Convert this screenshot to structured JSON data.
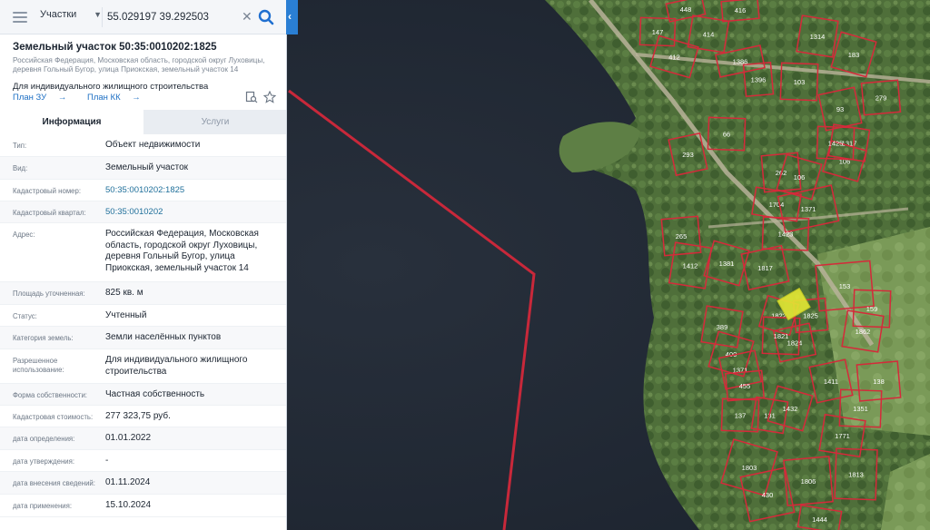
{
  "search": {
    "layer": "Участки",
    "query": "55.029197 39.292503"
  },
  "parcel": {
    "title": "Земельный участок 50:35:0010202:1825",
    "address": "Российская Федерация, Московская область, городской округ Луховицы, деревня Гольный Бугор, улица Приокская, земельный участок 14",
    "use": "Для индивидуального жилищного строительства",
    "plan_zu": "План ЗУ",
    "plan_kk": "План КК"
  },
  "tabs": {
    "info": "Информация",
    "services": "Услуги"
  },
  "fields": [
    {
      "label": "Тип:",
      "value": "Объект недвижимости"
    },
    {
      "label": "Вид:",
      "value": "Земельный участок"
    },
    {
      "label": "Кадастровый номер:",
      "value": "50:35:0010202:1825"
    },
    {
      "label": "Кадастровый квартал:",
      "value": "50:35:0010202"
    },
    {
      "label": "Адрес:",
      "value": "Российская Федерация, Московская область, городской округ Луховицы, деревня Гольный Бугор, улица Приокская, земельный участок 14"
    },
    {
      "label": "Площадь уточненная:",
      "value": "825 кв. м"
    },
    {
      "label": "Статус:",
      "value": "Учтенный"
    },
    {
      "label": "Категория земель:",
      "value": "Земли населённых пунктов"
    },
    {
      "label": "Разрешенное использование:",
      "value": "Для индивидуального жилищного строительства"
    },
    {
      "label": "Форма собственности:",
      "value": "Частная собственность"
    },
    {
      "label": "Кадастровая стоимость:",
      "value": "277 323,75 руб."
    },
    {
      "label": "дата определения:",
      "value": "01.01.2022"
    },
    {
      "label": "дата утверждения:",
      "value": "-"
    },
    {
      "label": "дата внесения сведений:",
      "value": "01.11.2024"
    },
    {
      "label": "дата применения:",
      "value": "15.10.2024"
    }
  ],
  "map": {
    "parcel_numbers": [
      "448",
      "416",
      "147",
      "414",
      "412",
      "1386",
      "1396",
      "103",
      "1314",
      "183",
      "93",
      "279",
      "66",
      "1317",
      "106",
      "293",
      "262",
      "1425",
      "1704",
      "106",
      "1371",
      "265",
      "1423",
      "1412",
      "1381",
      "1817",
      "153",
      "159",
      "1862",
      "1822",
      "1824",
      "1825",
      "1821",
      "389",
      "400",
      "1371",
      "455",
      "137",
      "131",
      "1432",
      "1411",
      "138",
      "1351",
      "1771",
      "1803",
      "430",
      "1806",
      "1813",
      "1444"
    ],
    "water_color": "#1e2633",
    "boundary_color": "#d52a3a",
    "highlight_color": "#e4e834"
  },
  "icons": {
    "menu": "menu-icon",
    "search": "search-icon",
    "clear": "clear-icon",
    "collapse": "chevron-left-icon",
    "tool1": "document-search-icon",
    "tool2": "star-icon"
  }
}
